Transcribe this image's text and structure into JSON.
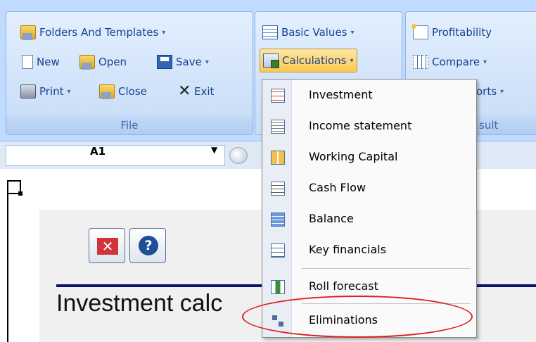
{
  "ribbon": {
    "file_group": {
      "caption": "File",
      "folders_templates": "Folders And Templates",
      "new": "New",
      "open": "Open",
      "save": "Save",
      "print": "Print",
      "close": "Close",
      "exit": "Exit"
    },
    "basic_group": {
      "basic_values": "Basic Values",
      "calculations": "Calculations"
    },
    "result_group": {
      "caption": "sult",
      "profitability": "Profitability",
      "compare": "Compare",
      "reports_partial": "orts"
    },
    "caret": "▾"
  },
  "formula_bar": {
    "name_box_value": "A1",
    "name_box_arrow": "▼"
  },
  "sheet": {
    "title_partial": "Investment calc",
    "close_glyph": "✕",
    "help_glyph": "?"
  },
  "menu": {
    "items": [
      {
        "label": "Investment",
        "icon": "investment-icon"
      },
      {
        "label": "Income statement",
        "icon": "income-statement-icon"
      },
      {
        "label": "Working Capital",
        "icon": "working-capital-icon"
      },
      {
        "label": "Cash Flow",
        "icon": "cash-flow-icon"
      },
      {
        "label": "Balance",
        "icon": "balance-icon"
      },
      {
        "label": "Key financials",
        "icon": "key-financials-icon"
      },
      {
        "label": "Roll forecast",
        "icon": "roll-forecast-icon"
      },
      {
        "label": "Eliminations",
        "icon": "eliminations-icon"
      }
    ]
  },
  "colors": {
    "ribbon_bg": "#bfdbff",
    "active_button": "#fbc84f",
    "highlight_ellipse": "#e01d1d",
    "title_rule": "#0a1272"
  }
}
